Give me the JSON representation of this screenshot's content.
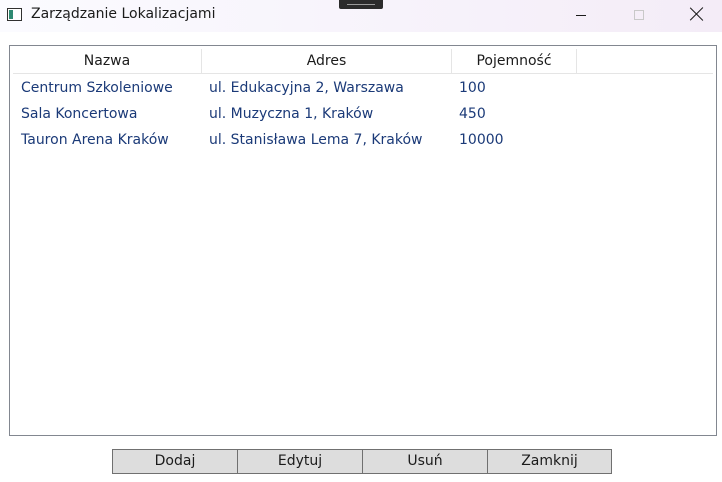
{
  "window": {
    "title": "Zarządzanie Lokalizacjami",
    "controls": [
      "minimize-icon",
      "maximize-icon",
      "close-icon"
    ]
  },
  "listview": {
    "columns": [
      "Nazwa",
      "Adres",
      "Pojemność"
    ],
    "rows": [
      [
        "Centrum Szkoleniowe",
        "ul. Edukacyjna 2, Warszawa",
        "100"
      ],
      [
        "Sala Koncertowa",
        "ul. Muzyczna 1, Kraków",
        "450"
      ],
      [
        "Tauron Arena Kraków",
        "ul. Stanisława Lema 7, Kraków",
        "10000"
      ]
    ]
  },
  "buttons": {
    "add": "Dodaj",
    "edit": "Edytuj",
    "delete": "Usuń",
    "close": "Zamknij"
  },
  "colors": {
    "row_text": "#1b3a78",
    "button_bg": "#dddddd",
    "border": "#828790"
  }
}
